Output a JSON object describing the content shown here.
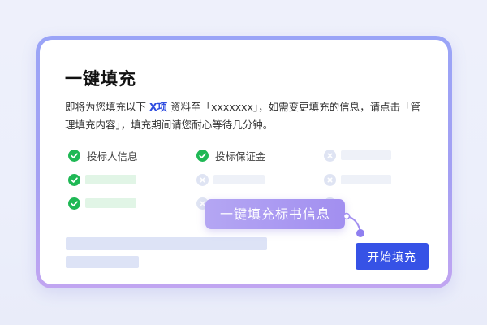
{
  "dialog": {
    "title": "一键填充",
    "description_prefix": "即将为您填充以下 ",
    "description_highlight": "X项",
    "description_suffix": " 资料至「xxxxxxx」，如需变更填充的信息，请点击「管理填充内容」，填充期间请您耐心等待几分钟。"
  },
  "checklist": {
    "items": [
      {
        "label": "投标人信息",
        "status": "done"
      },
      {
        "label": "投标保证金",
        "status": "done"
      },
      {
        "label": "",
        "status": "pending"
      },
      {
        "label": "",
        "status": "done"
      },
      {
        "label": "",
        "status": "pending"
      },
      {
        "label": "",
        "status": "pending"
      },
      {
        "label": "",
        "status": "done"
      },
      {
        "label": "",
        "status": "pending"
      },
      {
        "label": "",
        "status": "pending"
      }
    ]
  },
  "actions": {
    "start_label": "开始填充"
  },
  "tooltip": {
    "text": "一键填充标书信息"
  },
  "colors": {
    "accent": "#3652e6",
    "success": "#1fb855",
    "pending": "#dfe4f3",
    "tooltip": "#a28ff0",
    "frame": "#9aa4f7"
  }
}
